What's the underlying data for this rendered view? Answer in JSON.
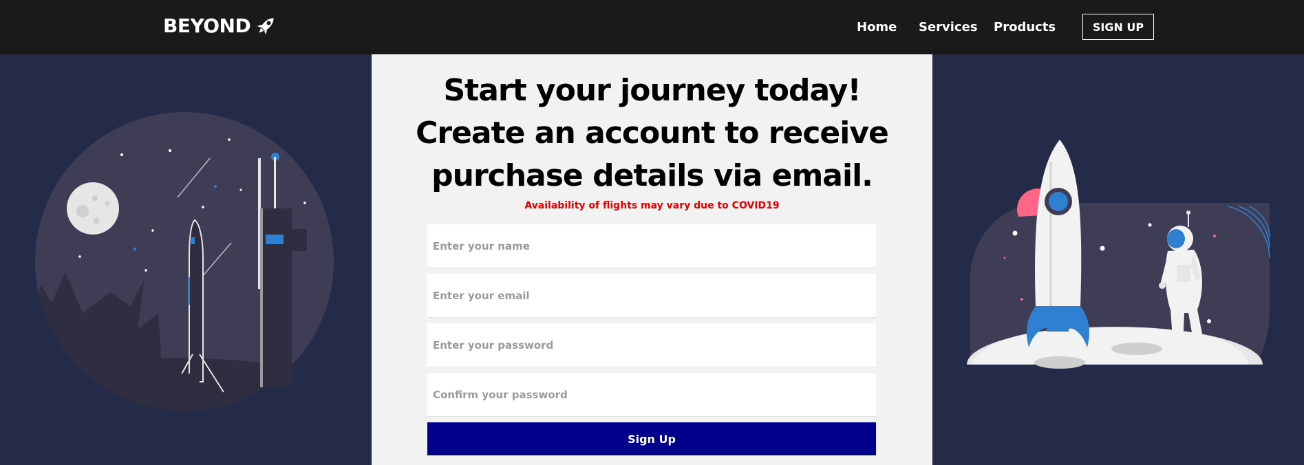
{
  "brand": {
    "name": "BEYOND",
    "icon": "rocket-icon"
  },
  "nav": {
    "home": "Home",
    "services": "Services",
    "products": "Products",
    "signup": "SIGN UP"
  },
  "form": {
    "headline_line1": "Start your journey today!",
    "headline_line2": "Create an account to receive",
    "headline_line3": "purchase details via email.",
    "notice": "Availability of flights may vary due to COVID19",
    "name_placeholder": "Enter your name",
    "email_placeholder": "Enter your email",
    "password_placeholder": "Enter your password",
    "confirm_placeholder": "Confirm your password",
    "submit_label": "Sign Up"
  },
  "colors": {
    "page_bg": "#242b48",
    "navbar_bg": "#1a1a1a",
    "panel_bg": "#f2f2f2",
    "notice": "#e00000",
    "submit_bg": "#00008b",
    "accent_blue": "#2f80d0"
  }
}
